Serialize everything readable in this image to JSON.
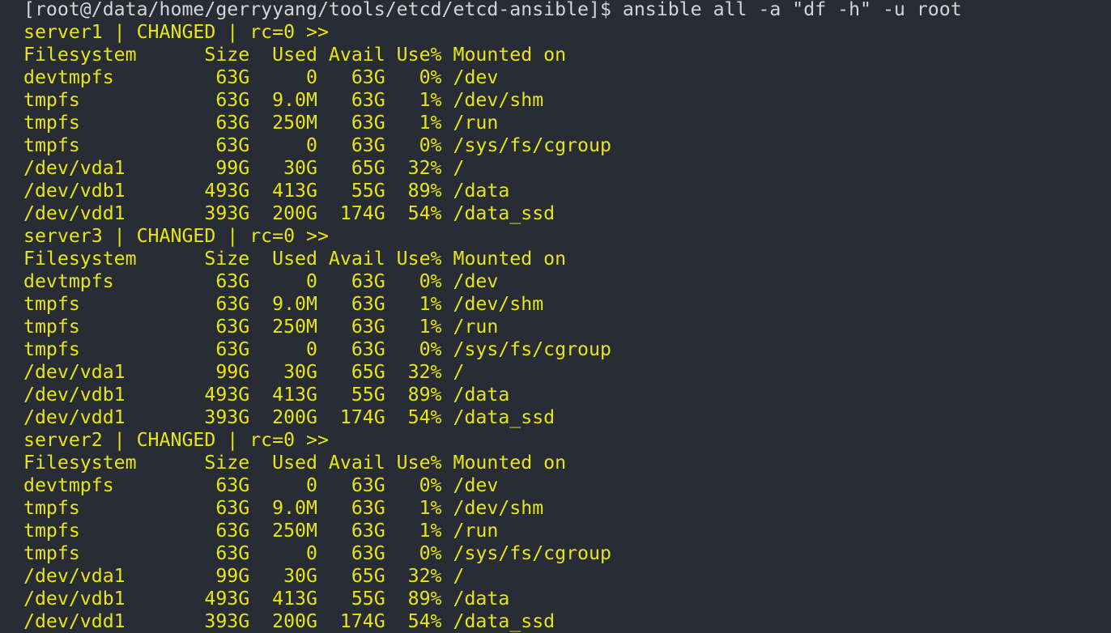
{
  "terminal": {
    "prompt": "[root@/data/home/gerryyang/tools/etcd/etcd-ansible]$ ansible all -a \"df -h\" -u root",
    "colors": {
      "background": "#282c35",
      "prompt": "#d4d4d4",
      "output": "#e8e515"
    },
    "columns": [
      "Filesystem",
      "Size",
      "Used",
      "Avail",
      "Use%",
      "Mounted on"
    ],
    "hosts": [
      {
        "header": "server1 | CHANGED | rc=0 >>",
        "rows": [
          [
            "devtmpfs",
            "63G",
            "0",
            "63G",
            "0%",
            "/dev"
          ],
          [
            "tmpfs",
            "63G",
            "9.0M",
            "63G",
            "1%",
            "/dev/shm"
          ],
          [
            "tmpfs",
            "63G",
            "250M",
            "63G",
            "1%",
            "/run"
          ],
          [
            "tmpfs",
            "63G",
            "0",
            "63G",
            "0%",
            "/sys/fs/cgroup"
          ],
          [
            "/dev/vda1",
            "99G",
            "30G",
            "65G",
            "32%",
            "/"
          ],
          [
            "/dev/vdb1",
            "493G",
            "413G",
            "55G",
            "89%",
            "/data"
          ],
          [
            "/dev/vdd1",
            "393G",
            "200G",
            "174G",
            "54%",
            "/data_ssd"
          ]
        ]
      },
      {
        "header": "server3 | CHANGED | rc=0 >>",
        "rows": [
          [
            "devtmpfs",
            "63G",
            "0",
            "63G",
            "0%",
            "/dev"
          ],
          [
            "tmpfs",
            "63G",
            "9.0M",
            "63G",
            "1%",
            "/dev/shm"
          ],
          [
            "tmpfs",
            "63G",
            "250M",
            "63G",
            "1%",
            "/run"
          ],
          [
            "tmpfs",
            "63G",
            "0",
            "63G",
            "0%",
            "/sys/fs/cgroup"
          ],
          [
            "/dev/vda1",
            "99G",
            "30G",
            "65G",
            "32%",
            "/"
          ],
          [
            "/dev/vdb1",
            "493G",
            "413G",
            "55G",
            "89%",
            "/data"
          ],
          [
            "/dev/vdd1",
            "393G",
            "200G",
            "174G",
            "54%",
            "/data_ssd"
          ]
        ]
      },
      {
        "header": "server2 | CHANGED | rc=0 >>",
        "rows": [
          [
            "devtmpfs",
            "63G",
            "0",
            "63G",
            "0%",
            "/dev"
          ],
          [
            "tmpfs",
            "63G",
            "9.0M",
            "63G",
            "1%",
            "/dev/shm"
          ],
          [
            "tmpfs",
            "63G",
            "250M",
            "63G",
            "1%",
            "/run"
          ],
          [
            "tmpfs",
            "63G",
            "0",
            "63G",
            "0%",
            "/sys/fs/cgroup"
          ],
          [
            "/dev/vda1",
            "99G",
            "30G",
            "65G",
            "32%",
            "/"
          ],
          [
            "/dev/vdb1",
            "493G",
            "413G",
            "55G",
            "89%",
            "/data"
          ],
          [
            "/dev/vdd1",
            "393G",
            "200G",
            "174G",
            "54%",
            "/data_ssd"
          ]
        ]
      }
    ]
  }
}
